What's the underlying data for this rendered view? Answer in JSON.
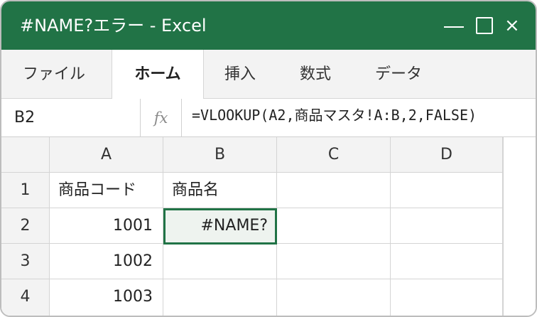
{
  "window": {
    "title": "#NAME?エラー - Excel",
    "controls": {
      "minimize": "—",
      "close": "×"
    }
  },
  "ribbon": {
    "tabs": [
      {
        "label": "ファイル",
        "active": false
      },
      {
        "label": "ホーム",
        "active": true
      },
      {
        "label": "挿入",
        "active": false
      },
      {
        "label": "数式",
        "active": false
      },
      {
        "label": "データ",
        "active": false
      }
    ]
  },
  "formula_bar": {
    "name_box": "B2",
    "fx_label": "fx",
    "formula": "=VLOOKUP(A2,商品マスタ!A:B,2,FALSE)"
  },
  "sheet": {
    "columns": [
      "A",
      "B",
      "C",
      "D"
    ],
    "rows": [
      {
        "row": "1",
        "A": "商品コード",
        "B": "商品名",
        "C": "",
        "D": ""
      },
      {
        "row": "2",
        "A": "1001",
        "B": "#NAME?",
        "C": "",
        "D": ""
      },
      {
        "row": "3",
        "A": "1002",
        "B": "",
        "C": "",
        "D": ""
      },
      {
        "row": "4",
        "A": "1003",
        "B": "",
        "C": "",
        "D": ""
      }
    ],
    "selected_cell": "B2"
  }
}
